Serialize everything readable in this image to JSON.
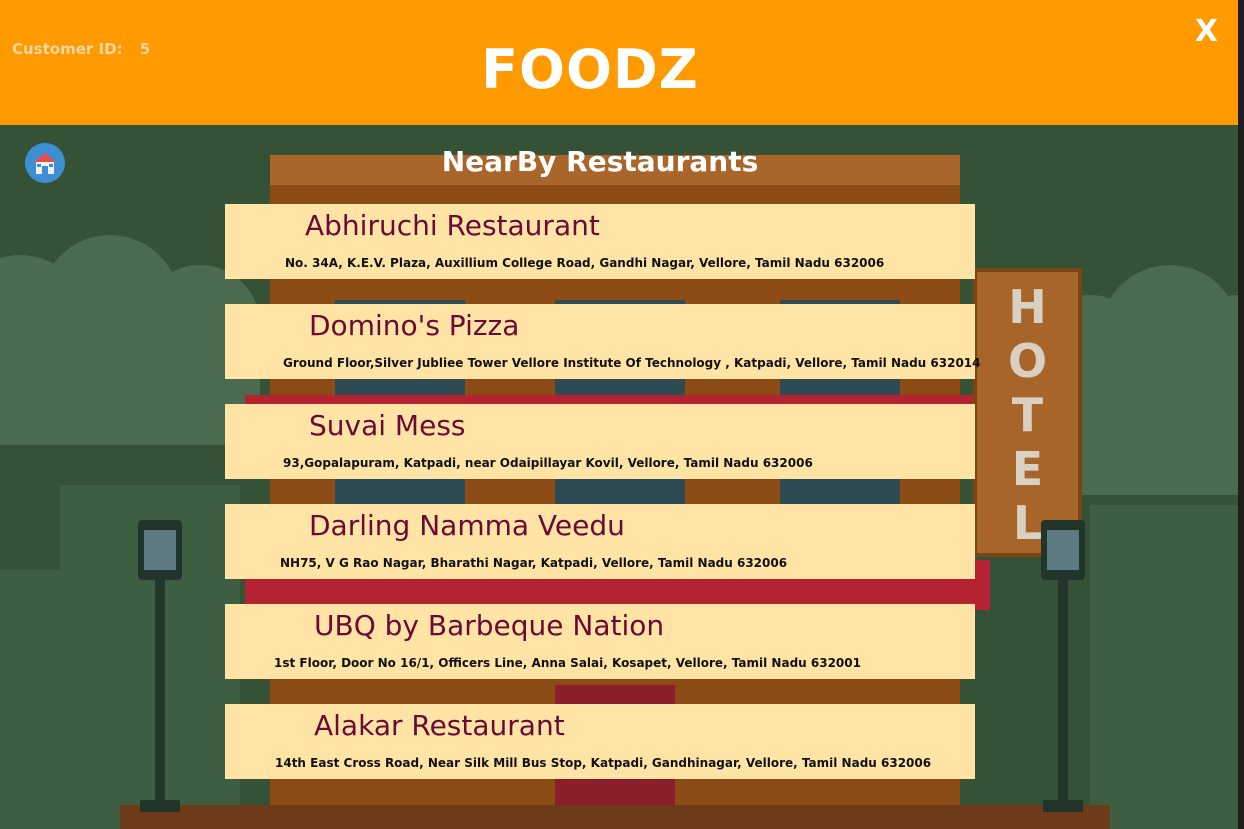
{
  "header": {
    "customer_label": "Customer ID:",
    "customer_id": "5",
    "app_title": "FOODZ",
    "close_label": "X"
  },
  "page": {
    "section_title": "NearBy Restaurants",
    "home_icon": "home-icon",
    "hotel_sign": [
      "H",
      "O",
      "T",
      "E",
      "L"
    ]
  },
  "restaurants": [
    {
      "name": "Abhiruchi Restaurant",
      "address": "No. 34A, K.E.V. Plaza, Auxillium College Road, Gandhi Nagar, Vellore, Tamil Nadu 632006"
    },
    {
      "name": "Domino's Pizza",
      "address": "Ground Floor,Silver Jubliee Tower Vellore Institute Of Technology , Katpadi, Vellore, Tamil Nadu 632014"
    },
    {
      "name": "Suvai Mess",
      "address": "93,Gopalapuram, Katpadi, near Odaipillayar Kovil, Vellore, Tamil Nadu 632006"
    },
    {
      "name": "Darling Namma Veedu",
      "address": "NH75, V G Rao Nagar, Bharathi Nagar, Katpadi, Vellore, Tamil Nadu 632006"
    },
    {
      "name": "UBQ by Barbeque Nation",
      "address": "1st Floor, Door No 16/1, Officers Line, Anna Salai, Kosapet, Vellore, Tamil Nadu 632001"
    },
    {
      "name": "Alakar Restaurant",
      "address": "14th East Cross Road, Near Silk Mill Bus Stop, Katpadi, Gandhinagar, Vellore, Tamil Nadu 632006"
    }
  ],
  "colors": {
    "header": "#ff9a00",
    "background": "#355236",
    "card": "#ffe4a6",
    "name_text": "#6b0a35"
  }
}
